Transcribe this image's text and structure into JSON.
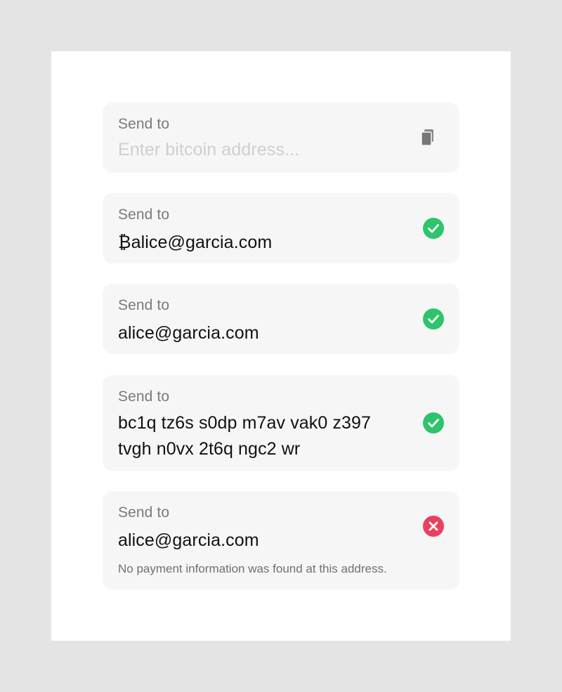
{
  "fields": [
    {
      "label": "Send to",
      "placeholder": "Enter bitcoin address...",
      "value": "",
      "status": "empty",
      "icon": "paste-icon"
    },
    {
      "label": "Send to",
      "value": "₿alice@garcia.com",
      "status": "valid",
      "icon": "check-circle-icon"
    },
    {
      "label": "Send to",
      "value": "alice@garcia.com",
      "status": "valid",
      "icon": "check-circle-icon"
    },
    {
      "label": "Send to",
      "value_lines": [
        "bc1q tz6s s0dp m7av vak0 z397",
        "tvgh n0vx 2t6q ngc2 wr"
      ],
      "status": "valid",
      "icon": "check-circle-icon"
    },
    {
      "label": "Send to",
      "value": "alice@garcia.com",
      "status": "invalid",
      "icon": "error-circle-icon",
      "error": "No payment information was found at this address."
    }
  ],
  "colors": {
    "background": "#e4e4e4",
    "card": "#ffffff",
    "field": "#f6f6f6",
    "success": "#2ec46b",
    "error": "#e8415f",
    "label": "#7a7a7a",
    "placeholder": "#cfcfcf"
  }
}
